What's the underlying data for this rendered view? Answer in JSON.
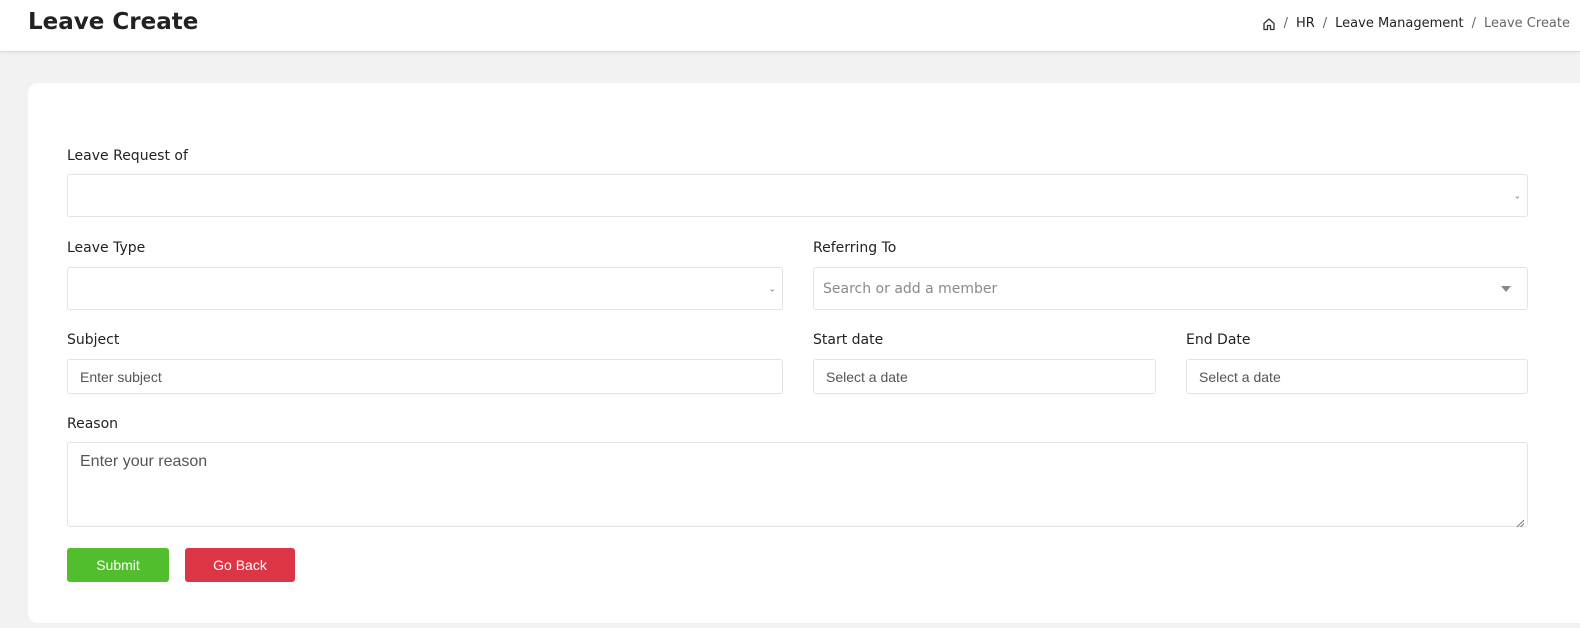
{
  "header": {
    "title": "Leave Create",
    "breadcrumb": {
      "home_icon": "home-icon",
      "separator": "/",
      "items": [
        "HR",
        "Leave Management"
      ],
      "current": "Leave Create"
    }
  },
  "form": {
    "leave_request_of": {
      "label": "Leave Request of",
      "value": ""
    },
    "leave_type": {
      "label": "Leave Type",
      "value": ""
    },
    "referring_to": {
      "label": "Referring To",
      "placeholder": "Search or add a member"
    },
    "subject": {
      "label": "Subject",
      "placeholder": "Enter subject"
    },
    "start_date": {
      "label": "Start date",
      "placeholder": "Select a date"
    },
    "end_date": {
      "label": "End Date",
      "placeholder": "Select a date"
    },
    "reason": {
      "label": "Reason",
      "placeholder": "Enter your reason"
    }
  },
  "actions": {
    "submit_label": "Submit",
    "go_back_label": "Go Back"
  },
  "colors": {
    "submit": "#52bd2d",
    "go_back": "#dc3545",
    "page_bg": "#f2f2f2",
    "card_bg": "#ffffff"
  }
}
